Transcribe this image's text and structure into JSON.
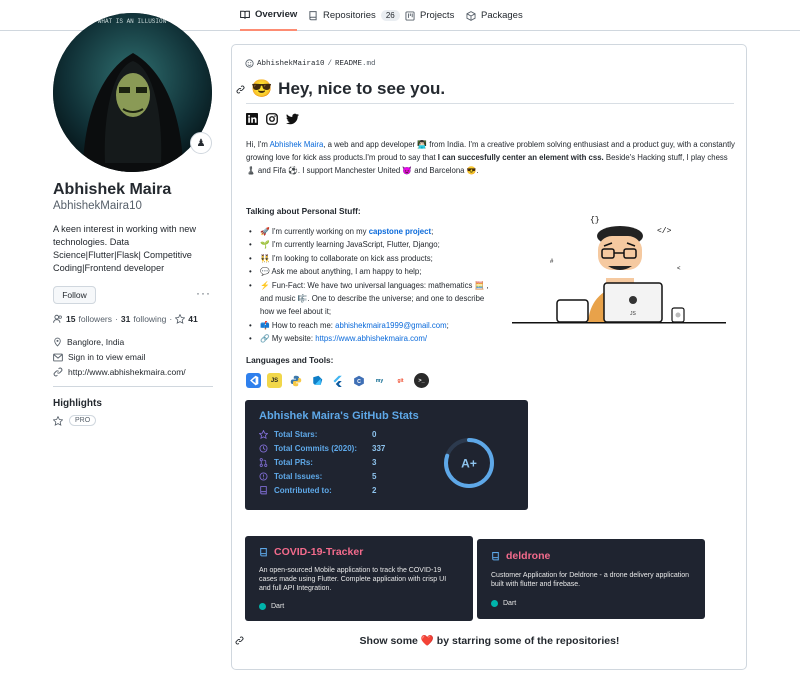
{
  "nav": {
    "tabs": [
      {
        "label": "Overview",
        "icon": "book-icon",
        "active": true
      },
      {
        "label": "Repositories",
        "icon": "repo-icon",
        "count": "26"
      },
      {
        "label": "Projects",
        "icon": "project-icon"
      },
      {
        "label": "Packages",
        "icon": "package-icon"
      }
    ]
  },
  "profile": {
    "avatar_text": "WHAT IS AN ILLUSION",
    "name": "Abhishek Maira",
    "username": "AbhishekMaira10",
    "bio": "A keen interest in working with new technologies. Data Science|Flutter|Flask| Competitive Coding|Frontend developer",
    "follow_label": "Follow",
    "more_label": "···",
    "followers_count": "15",
    "followers_label": "followers",
    "following_count": "31",
    "following_label": "following",
    "stars_count": "41",
    "dot": "·",
    "location": "Banglore, India",
    "email": "Sign in to view email",
    "website": "http://www.abhishekmaira.com/",
    "highlights_title": "Highlights",
    "pro_label": "PRO"
  },
  "readme": {
    "path_user": "AbhishekMaira10",
    "path_sep": "/",
    "path_file": "README",
    "path_ext": ".md",
    "heading_emoji": "😎",
    "heading": "Hey, nice to see you.",
    "intro": {
      "p1": "Hi, I'm ",
      "name_link": "Abhishek Maira",
      "p2": ", a web and app developer 👨🏻‍💻 from India. I'm a creative problem solving enthusiast and a product guy, with a constantly growing love for kick ass products.I'm proud to say that ",
      "bold": "I can succesfully center an element with css.",
      "p3": " Beside's Hacking stuff, I play chess ♟️ and Fifa ⚽. I support Manchester United 😈 and Barcelona 😎."
    },
    "talking_title": "Talking about Personal Stuff:",
    "bullets": [
      {
        "pre": "🚀 I'm currently working on my ",
        "bold_link": "capstone project",
        "post": ";"
      },
      {
        "pre": "🌱 I'm currently learning JavaScript, Flutter, Django;"
      },
      {
        "pre": "👯‍♂️ I'm looking to collaborate on kick ass products;"
      },
      {
        "pre": "💬 Ask me about anything, I am happy to help;"
      },
      {
        "pre": "⚡ Fun-Fact: We have two universal languages: mathematics 🧮 , and music 🎼. One to describe the universe; and one to describe how we feel about it;"
      },
      {
        "pre": "📫 How to reach me: ",
        "link": "abhishekmaira1999@gmail.com",
        "post": ";"
      },
      {
        "pre": "🔗 My website: ",
        "link": "https://www.abhishekmaira.com/"
      }
    ],
    "illus_code_left": "{}",
    "illus_code_right": "</>",
    "illus_js": "JS",
    "languages_title": "Languages and Tools:",
    "tools": [
      {
        "name": "vscode-icon",
        "label": "",
        "color": "#2f80ed"
      },
      {
        "name": "javascript-icon",
        "label": "JS",
        "color": "#f1d74a"
      },
      {
        "name": "python-icon",
        "label": "",
        "color": "#3c78aa"
      },
      {
        "name": "dart-icon",
        "label": "",
        "color": "#0f7ec7"
      },
      {
        "name": "flutter-icon",
        "label": "",
        "color": "#41b4f0"
      },
      {
        "name": "cplusplus-icon",
        "label": "C",
        "color": "#3f6fb5"
      },
      {
        "name": "mysql-icon",
        "label": "my",
        "color": "#e0e4ea"
      },
      {
        "name": "git-icon",
        "label": "git",
        "color": "#eef1f4"
      },
      {
        "name": "terminal-icon",
        "label": ">_",
        "color": "#2a2a2a"
      }
    ],
    "stats": {
      "title": "Abhishek Maira's GitHub Stats",
      "rows": [
        {
          "label": "Total Stars:",
          "value": "0",
          "icon": "star-icon"
        },
        {
          "label": "Total Commits (2020):",
          "value": "337",
          "icon": "history-icon"
        },
        {
          "label": "Total PRs:",
          "value": "3",
          "icon": "pull-request-icon"
        },
        {
          "label": "Total Issues:",
          "value": "5",
          "icon": "issue-icon"
        },
        {
          "label": "Contributed to:",
          "value": "2",
          "icon": "repo-icon"
        }
      ],
      "grade": "A+",
      "grade_progress": 0.8
    },
    "repos": [
      {
        "name": "COVID-19-Tracker",
        "description": "An open-sourced Mobile application to track the COVID-19 cases made using Flutter. Complete application with crisp UI and full API Integration.",
        "language": "Dart",
        "lang_color": "#00b4ab"
      },
      {
        "name": "deldrone",
        "description": "Customer Application for Deldrone - a drone delivery application built with flutter and firebase.",
        "language": "Dart",
        "lang_color": "#00b4ab"
      }
    ],
    "footer": {
      "pre": "Show some ",
      "heart": "❤️",
      "post": " by starring some of the repositories!"
    }
  },
  "colors": {
    "accent_tab": "#fd8c73",
    "link": "#0969da",
    "card_bg": "#1f2430",
    "stats_title": "#5ea8e8",
    "repo_title": "#f36b8c"
  }
}
